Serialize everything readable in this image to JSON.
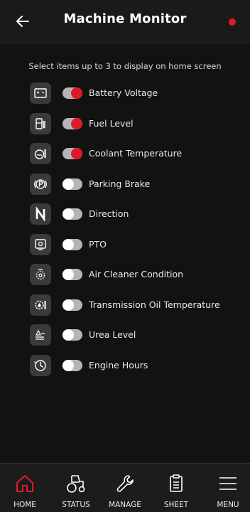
{
  "header": {
    "title": "Machine Monitor"
  },
  "instruction": "Select items up to 3 to display on home screen",
  "items": [
    {
      "label": "Battery Voltage",
      "icon": "battery-icon",
      "on": true
    },
    {
      "label": "Fuel Level",
      "icon": "fuel-icon",
      "on": true
    },
    {
      "label": "Coolant Temperature",
      "icon": "coolant-icon",
      "on": true
    },
    {
      "label": "Parking Brake",
      "icon": "parking-brake-icon",
      "on": false
    },
    {
      "label": "Direction",
      "icon": "direction-icon",
      "on": false
    },
    {
      "label": "PTO",
      "icon": "pto-icon",
      "on": false
    },
    {
      "label": "Air Cleaner Condition",
      "icon": "air-cleaner-icon",
      "on": false
    },
    {
      "label": "Transmission Oil Temperature",
      "icon": "transmission-oil-icon",
      "on": false
    },
    {
      "label": "Urea Level",
      "icon": "urea-icon",
      "on": false
    },
    {
      "label": "Engine Hours",
      "icon": "engine-hours-icon",
      "on": false
    }
  ],
  "nav": [
    {
      "label": "HOME",
      "icon": "home-icon",
      "active": true
    },
    {
      "label": "STATUS",
      "icon": "tractor-icon",
      "active": false
    },
    {
      "label": "MANAGE",
      "icon": "wrench-icon",
      "active": false
    },
    {
      "label": "SHEET",
      "icon": "clipboard-icon",
      "active": false
    },
    {
      "label": "MENU",
      "icon": "menu-icon",
      "active": false
    }
  ],
  "colors": {
    "accent": "#e0192a",
    "background": "#121212",
    "toggle_off": "#b5b5b5",
    "icon_tile": "#3a3a3a"
  }
}
